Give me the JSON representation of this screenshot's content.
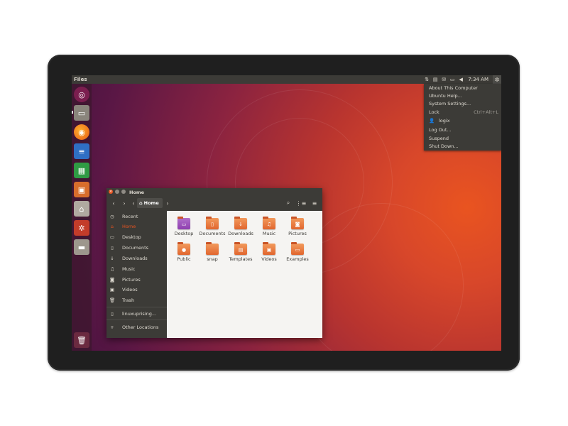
{
  "topbar": {
    "app_title": "Files",
    "clock": "7:34 AM"
  },
  "system_menu": {
    "items": [
      {
        "label": "About This Computer",
        "accel": ""
      },
      {
        "label": "Ubuntu Help...",
        "accel": ""
      },
      {
        "label": "System Settings...",
        "accel": ""
      },
      {
        "label": "Lock",
        "accel": "Ctrl+Alt+L"
      },
      {
        "label": "logix",
        "accel": ""
      },
      {
        "label": "Log Out...",
        "accel": ""
      },
      {
        "label": "Suspend",
        "accel": ""
      },
      {
        "label": "Shut Down...",
        "accel": ""
      }
    ]
  },
  "launcher": {
    "items": [
      "ubuntu-dash",
      "files",
      "firefox",
      "libreoffice-writer",
      "libreoffice-calc",
      "libreoffice-impress",
      "software-center",
      "system-settings",
      "drive",
      "trash"
    ]
  },
  "files": {
    "window_title": "Home",
    "breadcrumb": "Home",
    "sidebar": [
      {
        "icon": "clock-icon",
        "label": "Recent"
      },
      {
        "icon": "home-icon",
        "label": "Home"
      },
      {
        "icon": "desktop-icon",
        "label": "Desktop"
      },
      {
        "icon": "document-icon",
        "label": "Documents"
      },
      {
        "icon": "download-icon",
        "label": "Downloads"
      },
      {
        "icon": "music-icon",
        "label": "Music"
      },
      {
        "icon": "camera-icon",
        "label": "Pictures"
      },
      {
        "icon": "video-icon",
        "label": "Videos"
      },
      {
        "icon": "trash-icon",
        "label": "Trash"
      },
      {
        "icon": "usb-drive-icon",
        "label": "linuxuprising..."
      },
      {
        "icon": "plus-icon",
        "label": "Other Locations"
      }
    ],
    "folders": [
      {
        "label": "Desktop"
      },
      {
        "label": "Documents"
      },
      {
        "label": "Downloads"
      },
      {
        "label": "Music"
      },
      {
        "label": "Pictures"
      },
      {
        "label": "Public"
      },
      {
        "label": "snap"
      },
      {
        "label": "Templates"
      },
      {
        "label": "Videos"
      },
      {
        "label": "Examples"
      }
    ]
  },
  "colors": {
    "accent": "#e95420",
    "panel": "#3c3b37",
    "folder": "#f29a5c"
  }
}
